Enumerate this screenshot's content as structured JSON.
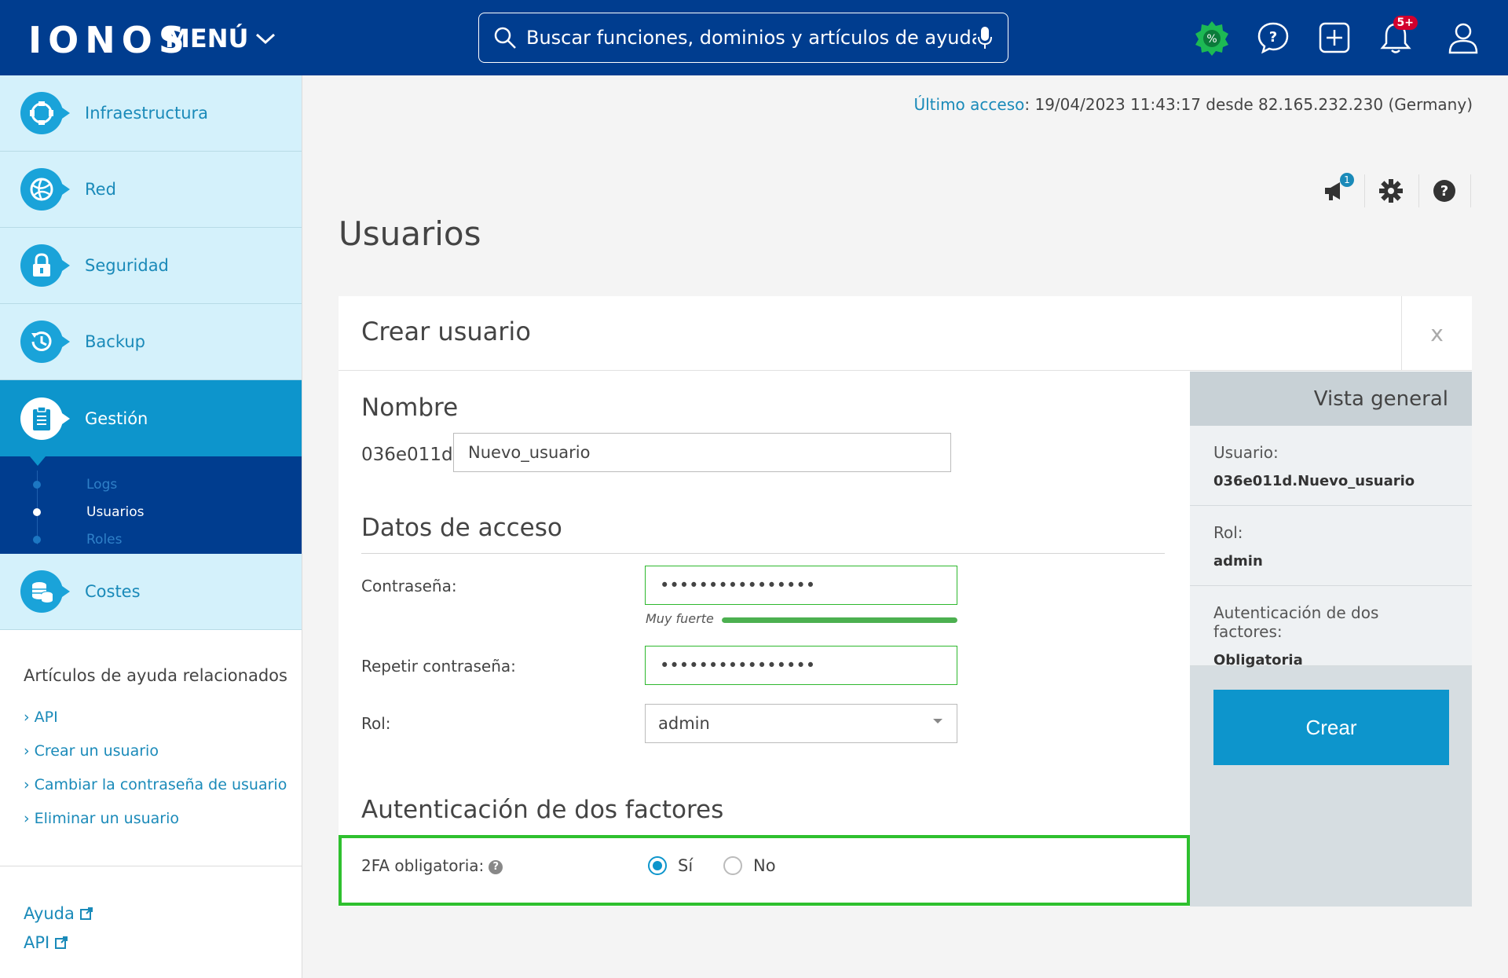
{
  "header": {
    "logo": "IONOS",
    "menu_label": "MENÚ",
    "search_placeholder": "Buscar funciones, dominios y artículos de ayuda",
    "notifications_badge": "5+",
    "brand_color": "#003d8f"
  },
  "sidebar": {
    "items": [
      {
        "label": "Infraestructura",
        "icon": "infrastructure-icon"
      },
      {
        "label": "Red",
        "icon": "network-globe-icon"
      },
      {
        "label": "Seguridad",
        "icon": "lock-icon"
      },
      {
        "label": "Backup",
        "icon": "backup-clock-icon"
      },
      {
        "label": "Gestión",
        "icon": "clipboard-icon",
        "active": true
      },
      {
        "label": "Costes",
        "icon": "coins-icon"
      }
    ],
    "subitems": [
      {
        "label": "Logs"
      },
      {
        "label": "Usuarios",
        "active": true
      },
      {
        "label": "Roles"
      }
    ],
    "help_title": "Artículos de ayuda relacionados",
    "help_links": [
      "API",
      "Crear un usuario",
      "Cambiar la contraseña de usuario",
      "Eliminar un usuario"
    ],
    "footer_links": [
      "Ayuda",
      "API"
    ]
  },
  "main": {
    "last_access_label": "Último acceso",
    "last_access_value": ": 19/04/2023 11:43:17 desde 82.165.232.230 (Germany)",
    "announcements_badge": "1",
    "page_title": "Usuarios",
    "card_title": "Crear usuario",
    "close_label": "x",
    "name_section": "Nombre",
    "name_prefix": "036e011d.",
    "name_value": "Nuevo_usuario",
    "access_section": "Datos de acceso",
    "password_label": "Contraseña:",
    "password_value": "••••••••••••••••",
    "strength_label": "Muy fuerte",
    "strength_level": 1.0,
    "repeat_password_label": "Repetir contraseña:",
    "repeat_password_value": "••••••••••••••••",
    "role_label": "Rol:",
    "role_value": "admin",
    "twofa_section": "Autenticación de dos factores",
    "twofa_label": "2FA obligatoria:",
    "twofa_options": [
      {
        "label": "Sí",
        "checked": true
      },
      {
        "label": "No",
        "checked": false
      }
    ]
  },
  "overview": {
    "title": "Vista general",
    "rows": [
      {
        "key": "Usuario:",
        "value": "036e011d.Nuevo_usuario"
      },
      {
        "key": "Rol:",
        "value": "admin"
      },
      {
        "key": "Autenticación de dos factores:",
        "value": "Obligatoria"
      }
    ],
    "create_button": "Crear"
  }
}
